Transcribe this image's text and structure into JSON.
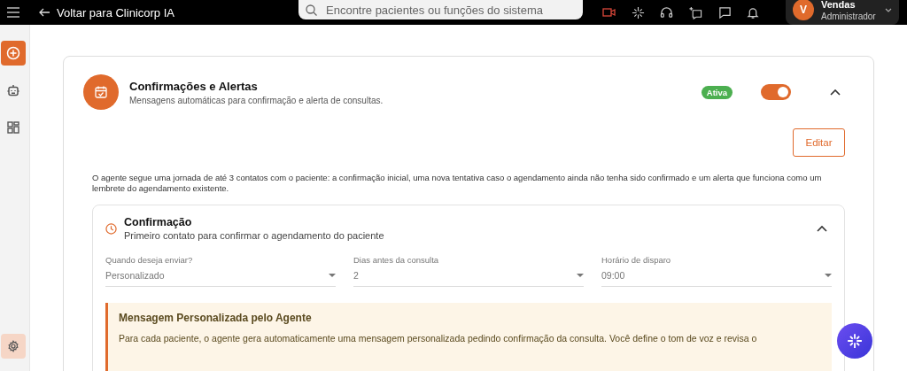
{
  "topbar": {
    "back_label": "Voltar para Clinicorp IA",
    "search": {
      "placeholder": "Encontre pacientes ou funções do sistema"
    },
    "user": {
      "initial": "V",
      "name": "Vendas",
      "role": "Administrador"
    }
  },
  "sidebar": {
    "items": [
      {
        "kind": "add",
        "selected": true
      },
      {
        "kind": "robot",
        "selected": false
      },
      {
        "kind": "grid",
        "selected": false
      }
    ]
  },
  "card": {
    "title": "Confirmações e Alertas",
    "subtitle": "Mensagens automáticas para confirmação e alerta de consultas.",
    "status": "Ativa",
    "on": true,
    "expanded": true,
    "edit_button": "Editar",
    "description": "O agente segue uma jornada de até 3 contatos com o paciente: a confirmação inicial, uma nova tentativa caso o agendamento ainda não tenha sido confirmado e um alerta que funciona como um lembrete do agendamento existente.",
    "section": {
      "title": "Confirmação",
      "subtitle": "Primeiro contato para confirmar o agendamento do paciente",
      "expanded": true,
      "fields": [
        {
          "label": "Quando deseja enviar?",
          "value": "Personalizado"
        },
        {
          "label": "Dias antes da consulta",
          "value": "2"
        },
        {
          "label": "Horário de disparo",
          "value": "09:00"
        }
      ],
      "notice": {
        "title": "Mensagem Personalizada pelo Agente",
        "text": "Para cada paciente, o agente gera automaticamente uma mensagem personalizada pedindo confirmação da consulta. Você define o tom de voz e revisa o"
      }
    }
  }
}
